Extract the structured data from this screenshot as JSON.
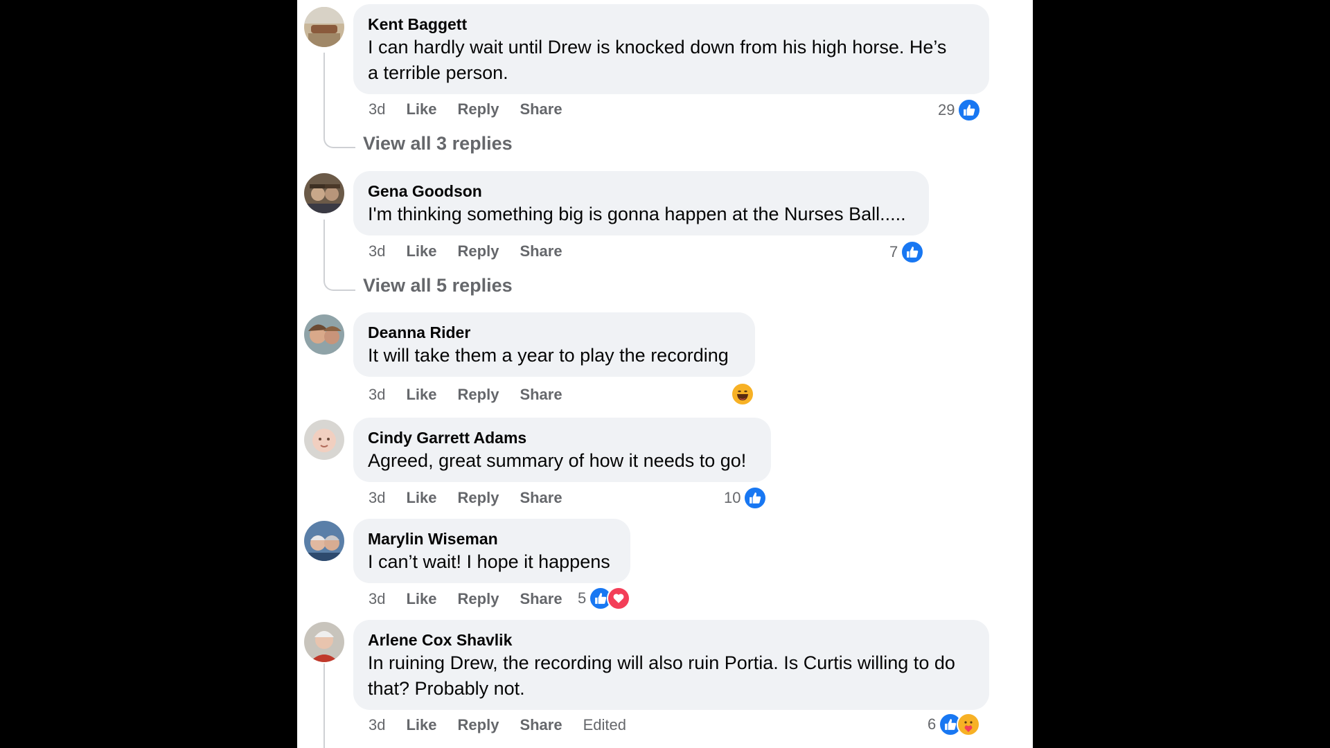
{
  "comments": [
    {
      "name": "Kent Baggett",
      "text_lines": [
        "I can hardly wait until Drew is knocked down from his high horse. He’s",
        "a terrible person."
      ],
      "time": "3d",
      "like": "Like",
      "reply": "Reply",
      "share": "Share",
      "reactions": {
        "count": "29",
        "icons": [
          "like-icon"
        ]
      },
      "replies_link": "View all 3 replies"
    },
    {
      "name": "Gena Goodson",
      "text_lines": [
        "I'm thinking something big is gonna happen at the Nurses Ball....."
      ],
      "time": "3d",
      "like": "Like",
      "reply": "Reply",
      "share": "Share",
      "reactions": {
        "count": "7",
        "icons": [
          "like-icon"
        ]
      },
      "replies_link": "View all 5 replies"
    },
    {
      "name": "Deanna Rider",
      "text_lines": [
        "It will take them a year to play the recording"
      ],
      "time": "3d",
      "like": "Like",
      "reply": "Reply",
      "share": "Share",
      "reactions": {
        "count": "",
        "icons": [
          "haha-icon"
        ]
      }
    },
    {
      "name": "Cindy Garrett Adams",
      "text_lines": [
        "Agreed, great summary of how it needs to go!"
      ],
      "time": "3d",
      "like": "Like",
      "reply": "Reply",
      "share": "Share",
      "reactions": {
        "count": "10",
        "icons": [
          "like-icon"
        ]
      }
    },
    {
      "name": "Marylin Wiseman",
      "text_lines": [
        "I can’t wait! I hope it happens"
      ],
      "time": "3d",
      "like": "Like",
      "reply": "Reply",
      "share": "Share",
      "reactions": {
        "count": "5",
        "icons": [
          "like-icon",
          "love-icon"
        ]
      }
    },
    {
      "name": "Arlene Cox Shavlik",
      "text_lines": [
        "In ruining Drew, the recording will also ruin Portia. Is Curtis willing to do",
        "that? Probably not."
      ],
      "time": "3d",
      "like": "Like",
      "reply": "Reply",
      "share": "Share",
      "edited": "Edited",
      "reactions": {
        "count": "6",
        "icons": [
          "like-icon",
          "care-icon"
        ]
      }
    }
  ],
  "colors": {
    "bubble": "#f0f2f5",
    "like": "#1877f2",
    "love": "#f33e58",
    "haha": "#f7b125",
    "meta_text": "#65676b"
  }
}
